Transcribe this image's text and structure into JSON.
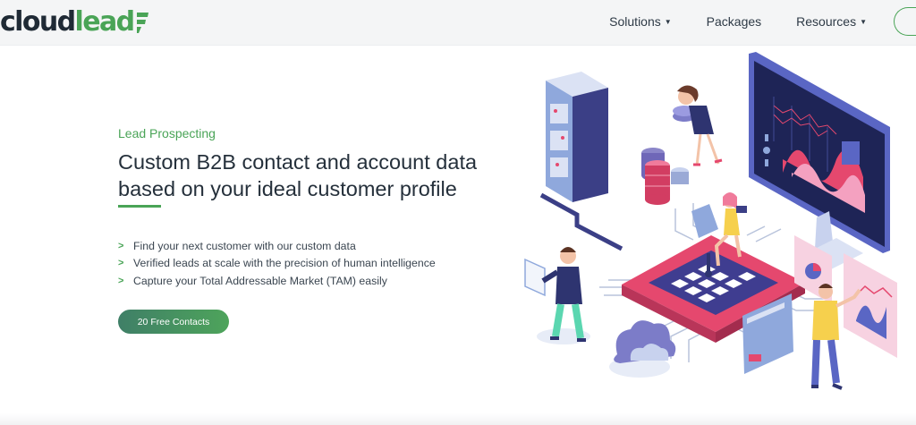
{
  "brand": {
    "logo_part1": "cloud",
    "logo_part2": "lead",
    "green": "#4aa457",
    "dark": "#1f2a35"
  },
  "nav": {
    "items": [
      {
        "label": "Solutions",
        "has_dropdown": true
      },
      {
        "label": "Packages",
        "has_dropdown": false
      },
      {
        "label": "Resources",
        "has_dropdown": true
      }
    ]
  },
  "hero": {
    "kicker": "Lead Prospecting",
    "title": "Custom B2B contact and account data based on your ideal customer profile",
    "bullets": [
      "Find your next customer with our custom data",
      "Verified leads at scale with the precision of human intelligence",
      "Capture your Total Addressable Market (TAM) easily"
    ],
    "cta": "20 Free Contacts"
  },
  "illustration": {
    "icon": "isometric-data-center-illustration"
  }
}
